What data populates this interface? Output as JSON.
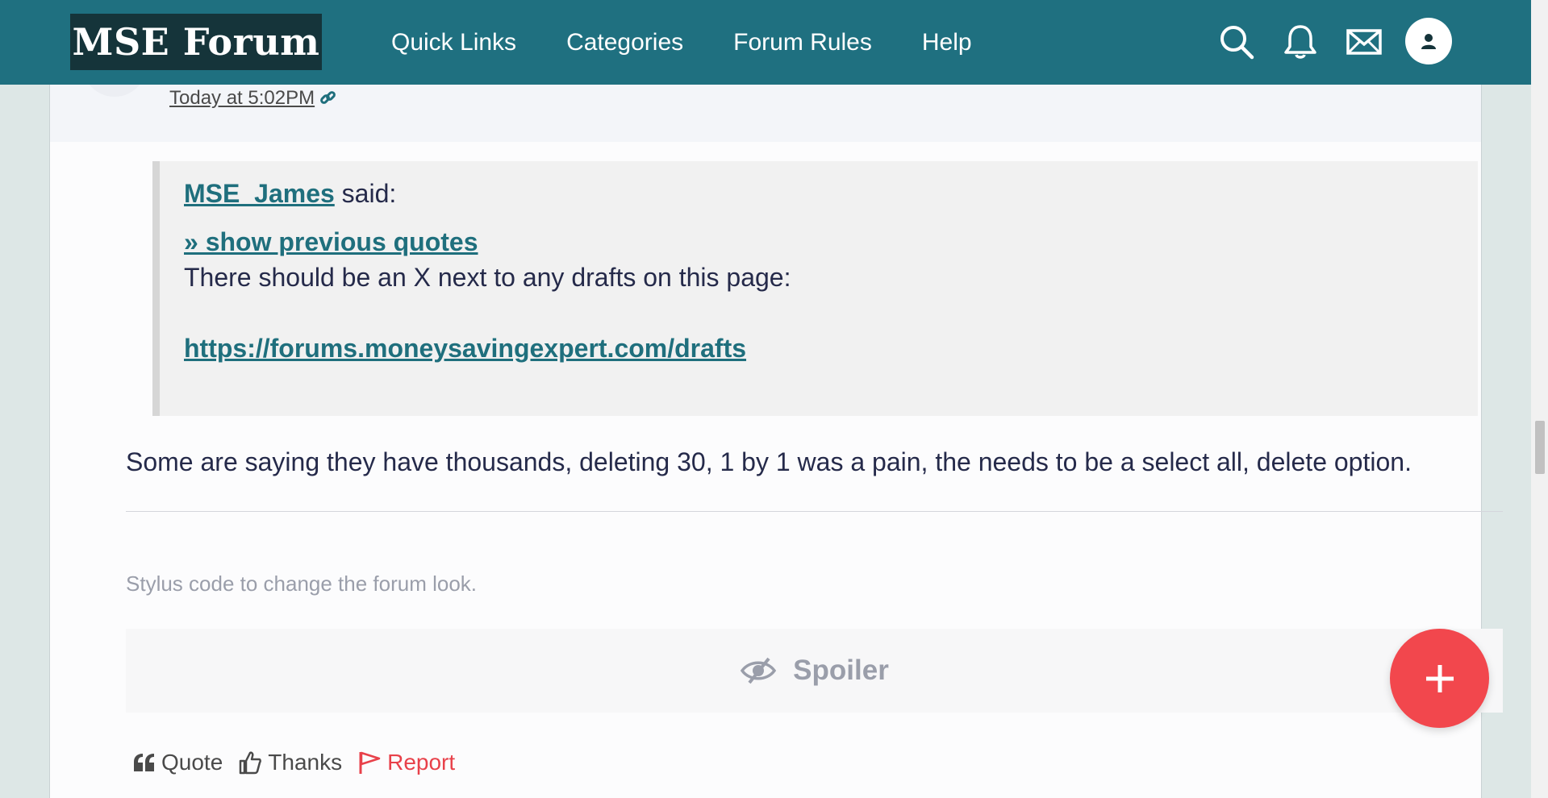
{
  "header": {
    "logo": "MSE Forum",
    "nav": [
      "Quick Links",
      "Categories",
      "Forum Rules",
      "Help"
    ],
    "icons": [
      "search-icon",
      "bell-icon",
      "mail-icon",
      "user-icon"
    ]
  },
  "post": {
    "time": "Today at 5:02PM",
    "quote": {
      "user": "MSE_James",
      "said": " said:",
      "show_previous": "» show previous quotes",
      "text": "There should be an X next to any drafts on this page:",
      "link": "https://forums.moneysavingexpert.com/drafts"
    },
    "body": "Some are saying they have thousands, deleting 30, 1 by 1 was a pain, the needs to be a select all, delete option.",
    "signature": "Stylus code to change the forum look.",
    "spoiler_label": "Spoiler",
    "actions": {
      "quote": "Quote",
      "thanks": "Thanks",
      "report": "Report"
    }
  },
  "colors": {
    "header_bg": "#1f7080",
    "logo_bg": "#15343a",
    "link": "#1f6f7d",
    "report": "#e8414a",
    "fab": "#f2474d"
  }
}
